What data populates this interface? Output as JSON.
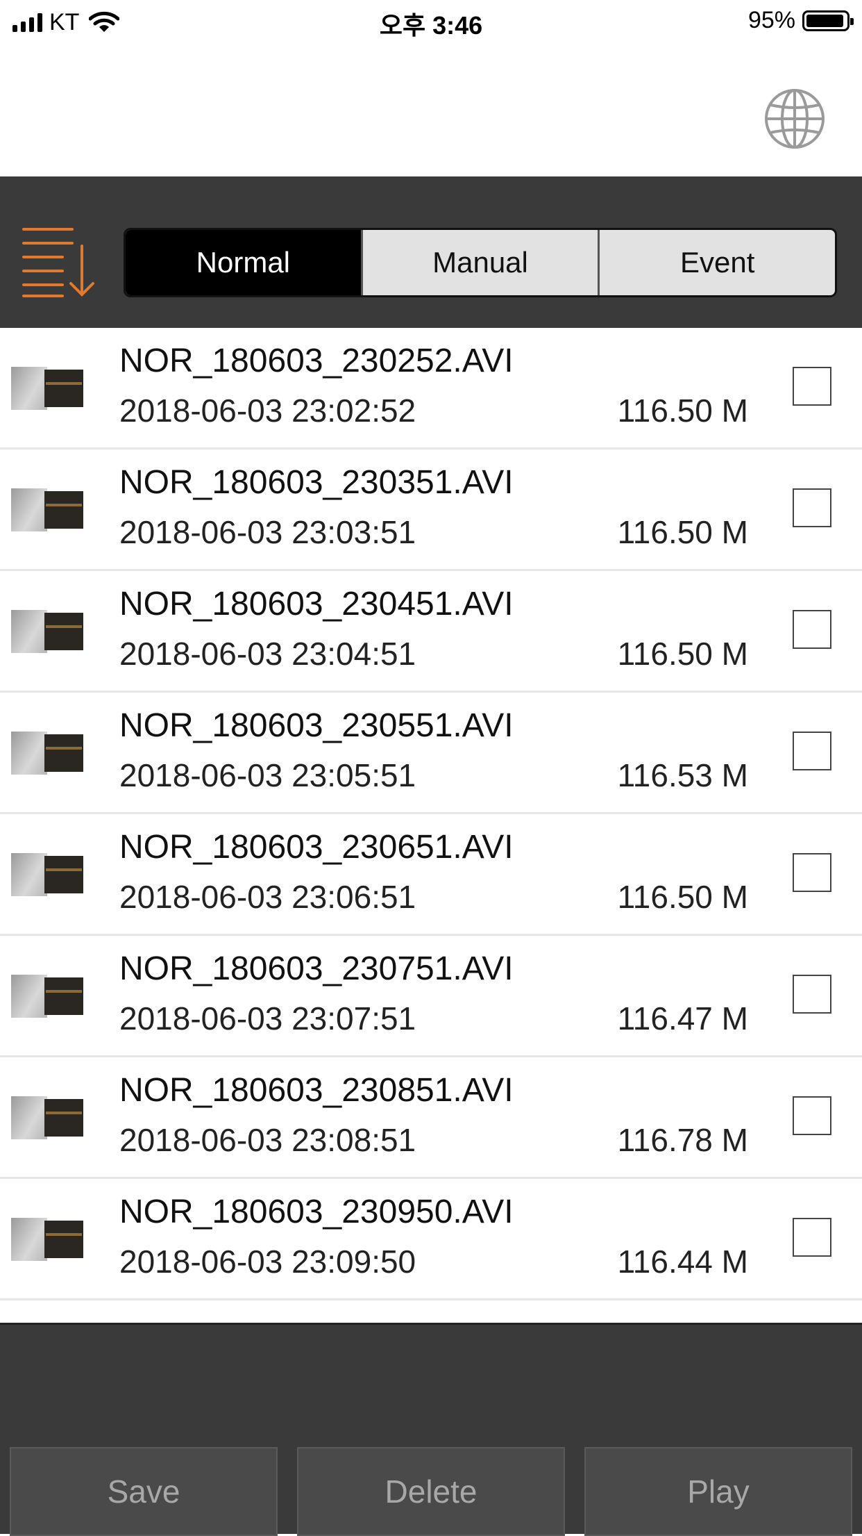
{
  "status_bar": {
    "carrier": "KT",
    "time": "오후 3:46",
    "battery_percent": "95%",
    "battery_level": 0.95
  },
  "header": {
    "globe_icon": "globe-icon"
  },
  "toolbar": {
    "sort_icon": "sort-descending-icon",
    "accent_color": "#e07a2e",
    "tabs": [
      {
        "label": "Normal",
        "active": true
      },
      {
        "label": "Manual",
        "active": false
      },
      {
        "label": "Event",
        "active": false
      }
    ]
  },
  "files": [
    {
      "name": "NOR_180603_230252.AVI",
      "date": "2018-06-03 23:02:52",
      "size": "116.50 M",
      "checked": false
    },
    {
      "name": "NOR_180603_230351.AVI",
      "date": "2018-06-03 23:03:51",
      "size": "116.50 M",
      "checked": false
    },
    {
      "name": "NOR_180603_230451.AVI",
      "date": "2018-06-03 23:04:51",
      "size": "116.50 M",
      "checked": false
    },
    {
      "name": "NOR_180603_230551.AVI",
      "date": "2018-06-03 23:05:51",
      "size": "116.53 M",
      "checked": false
    },
    {
      "name": "NOR_180603_230651.AVI",
      "date": "2018-06-03 23:06:51",
      "size": "116.50 M",
      "checked": false
    },
    {
      "name": "NOR_180603_230751.AVI",
      "date": "2018-06-03 23:07:51",
      "size": "116.47 M",
      "checked": false
    },
    {
      "name": "NOR_180603_230851.AVI",
      "date": "2018-06-03 23:08:51",
      "size": "116.78 M",
      "checked": false
    },
    {
      "name": "NOR_180603_230950.AVI",
      "date": "2018-06-03 23:09:50",
      "size": "116.44 M",
      "checked": false
    }
  ],
  "actions": {
    "save_label": "Save",
    "delete_label": "Delete",
    "play_label": "Play"
  }
}
